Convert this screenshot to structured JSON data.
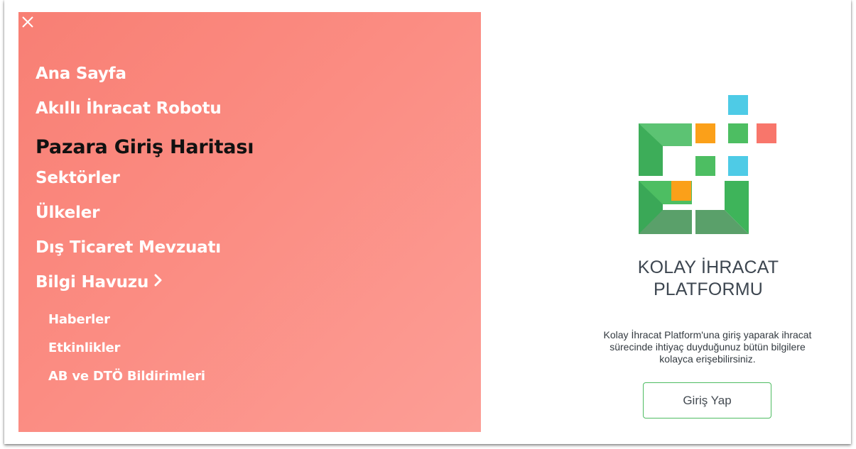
{
  "menu": {
    "close_icon": "close-icon",
    "items": [
      {
        "label": "Ana Sayfa"
      },
      {
        "label": "Akıllı İhracat Robotu"
      },
      {
        "label": "Pazara Giriş Haritası",
        "active": true
      },
      {
        "label": "Sektörler"
      },
      {
        "label": "Ülkeler"
      },
      {
        "label": "Dış Ticaret Mevzuatı"
      },
      {
        "label": "Bilgi Havuzu",
        "icon": "chevron-right-icon"
      }
    ],
    "sub_items": [
      {
        "label": "Haberler"
      },
      {
        "label": "Etkinlikler"
      },
      {
        "label": "AB ve DTÖ Bildirimleri"
      }
    ]
  },
  "brand": {
    "title_line1": "KOLAY İHRACAT",
    "title_line2": "PLATFORMU",
    "description": "Kolay İhracat Platform'una giriş yaparak ihracat sürecinde ihtiyaç duyduğunuz bütün bilgilere kolayca erişebilirsiniz.",
    "login_label": "Giriş Yap"
  },
  "colors": {
    "menu_background": "#fa8a80",
    "active_item": "#111111",
    "menu_text": "#ffffff",
    "logo_green": "#4dbe62",
    "logo_orange": "#fba019",
    "logo_cyan": "#4ecbe6",
    "logo_red": "#f8766b",
    "button_border": "#4ebc62"
  }
}
